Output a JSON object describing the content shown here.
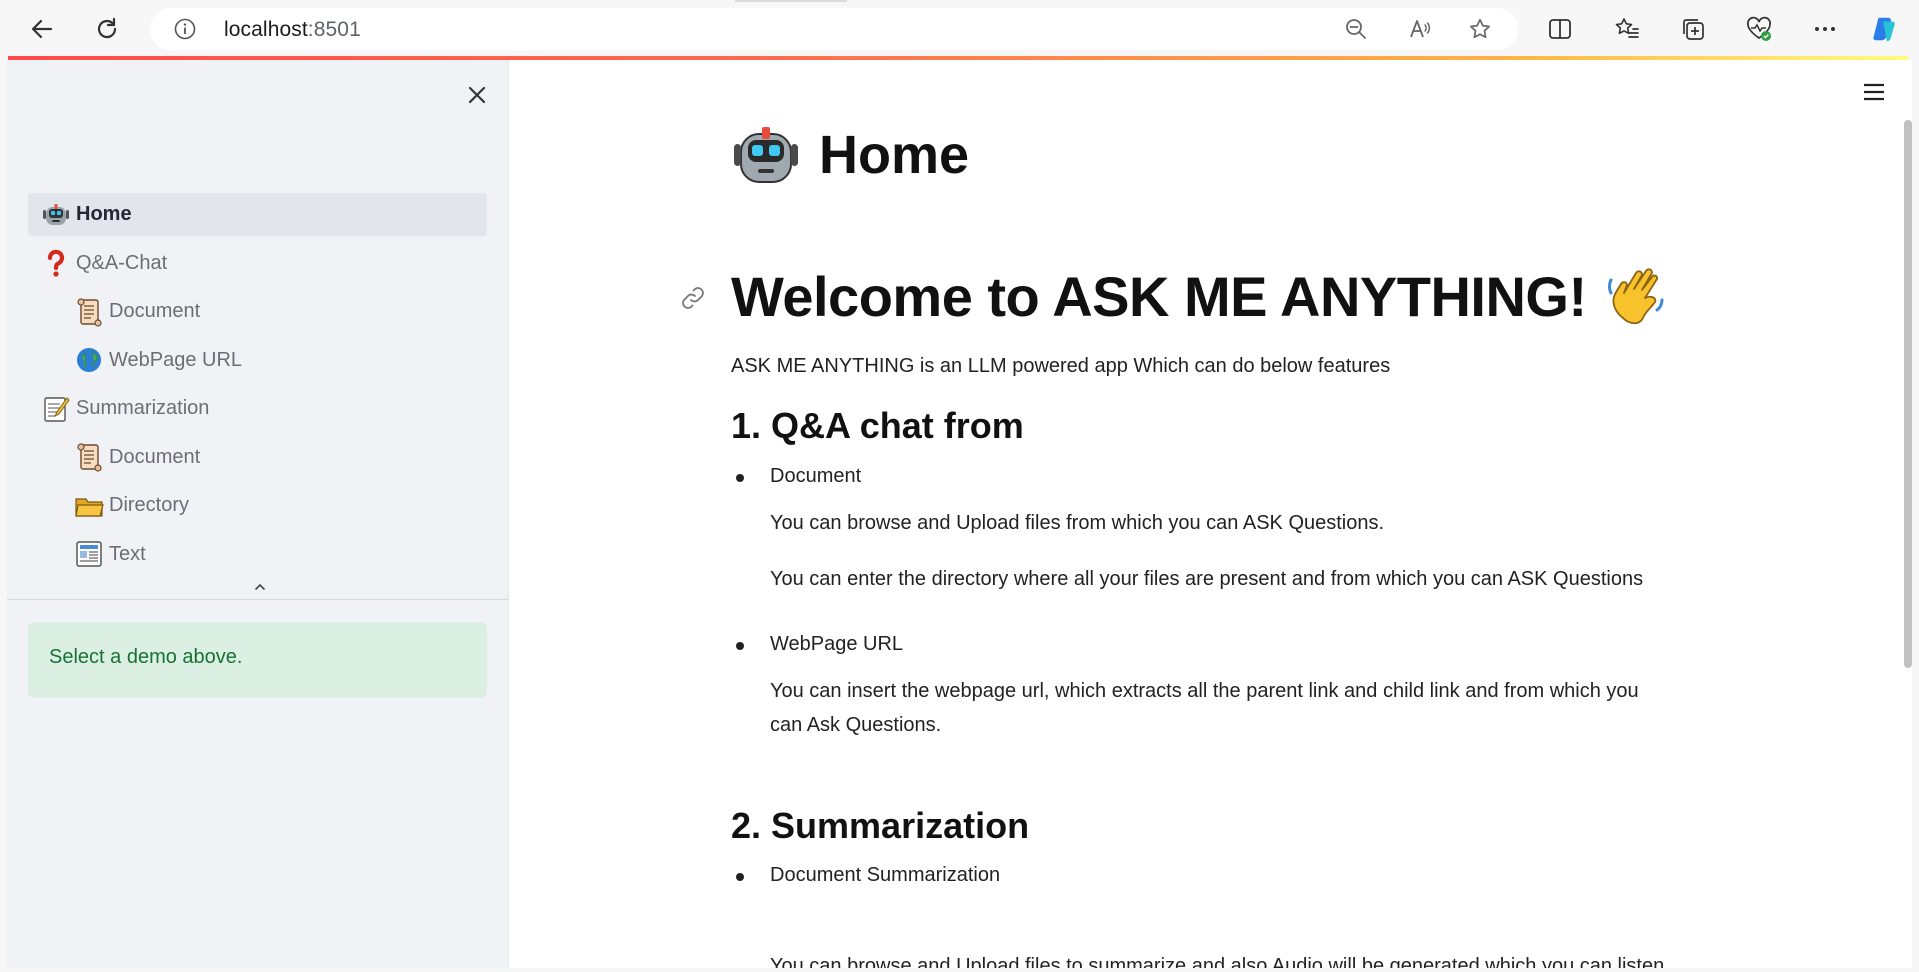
{
  "browser": {
    "url_host": "localhost",
    "url_port": ":8501"
  },
  "sidebar": {
    "items": [
      {
        "label": "Home",
        "icon": "robot-icon",
        "active": true,
        "sub": false
      },
      {
        "label": "Q&A-Chat",
        "icon": "question-mark-icon",
        "active": false,
        "sub": false
      },
      {
        "label": "Document",
        "icon": "scroll-icon",
        "active": false,
        "sub": true
      },
      {
        "label": "WebPage URL",
        "icon": "globe-icon",
        "active": false,
        "sub": true
      },
      {
        "label": "Summarization",
        "icon": "memo-icon",
        "active": false,
        "sub": false
      },
      {
        "label": "Document",
        "icon": "scroll-icon",
        "active": false,
        "sub": true
      },
      {
        "label": "Directory",
        "icon": "folder-icon",
        "active": false,
        "sub": true
      },
      {
        "label": "Text",
        "icon": "newspaper-icon",
        "active": false,
        "sub": true
      }
    ],
    "info": "Select a demo above."
  },
  "main": {
    "page_title": "Home",
    "welcome": "Welcome to ASK ME ANYTHING!",
    "intro": "ASK ME ANYTHING is an LLM powered app Which can do below features",
    "section1": {
      "heading": "1. Q&A chat from",
      "item1": "Document",
      "item1_p1": "You can browse and Upload files from which you can ASK Questions.",
      "item1_p2": "You can enter the directory where all your files are present and from which you can ASK Questions",
      "item2": "WebPage URL",
      "item2_p1": "You can insert the webpage url, which extracts all the parent link and child link and from which you can Ask Questions."
    },
    "section2": {
      "heading": "2. Summarization",
      "item1": "Document Summarization",
      "item1_p1": "You can browse and Upload files to summarize and also Audio will be generated which you can listen"
    }
  },
  "colors": {
    "accent": "#ff4b4b",
    "sidebar_bg": "#f0f2f6",
    "info_bg": "#dcefe3",
    "info_text": "#177233"
  }
}
